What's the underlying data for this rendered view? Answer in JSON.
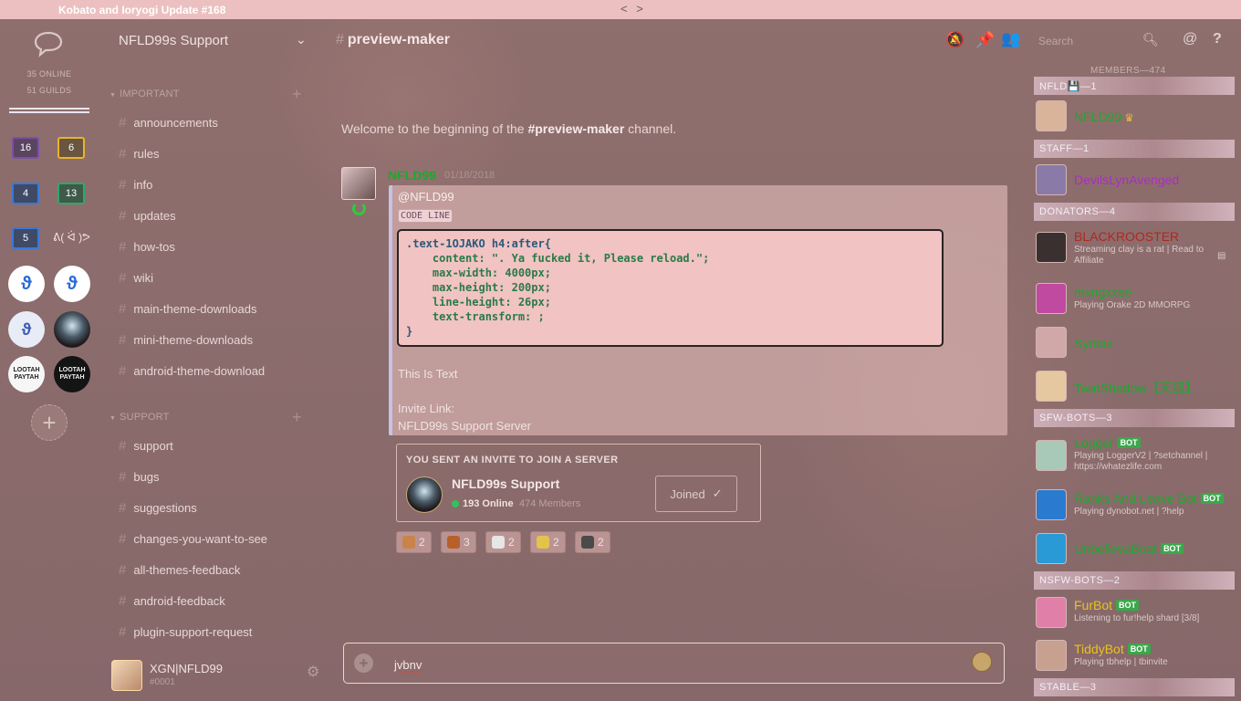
{
  "window": {
    "title": "Kobato and Ioryogi Update #168",
    "nav": "< >"
  },
  "guilds": {
    "online": "35 ONLINE",
    "guild_count": "51 GUILDS",
    "folders": [
      {
        "count": "16",
        "color": "#7c4fa8"
      },
      {
        "count": "6",
        "color": "#e8b42a"
      },
      {
        "count": "4",
        "color": "#3a78d6"
      },
      {
        "count": "13",
        "color": "#2fa86a"
      },
      {
        "count": "5",
        "color": "#3a78d6"
      }
    ],
    "lenny": "ᕕ( ᐛ )ᕗ",
    "lootah_label": "LOOTAH PAYTAH",
    "add_label": "+"
  },
  "server": {
    "name": "NFLD99s Support",
    "categories": [
      {
        "name": "IMPORTANT",
        "channels": [
          "announcements",
          "rules",
          "info",
          "updates",
          "how-tos",
          "wiki",
          "main-theme-downloads",
          "mini-theme-downloads",
          "android-theme-download"
        ]
      },
      {
        "name": "SUPPORT",
        "channels": [
          "support",
          "bugs",
          "suggestions",
          "changes-you-want-to-see",
          "all-themes-feedback",
          "android-feedback",
          "plugin-support-request"
        ]
      }
    ]
  },
  "user": {
    "name": "XGN|NFLD99",
    "tag": "#0001"
  },
  "header": {
    "channel": "preview-maker",
    "search_placeholder": "Search"
  },
  "chat": {
    "welcome_pre": "Welcome to the beginning of the ",
    "welcome_channel": "#preview-maker",
    "welcome_post": " channel.",
    "message": {
      "author": "NFLD99",
      "time": "01/18/2018",
      "mention": "@NFLD99",
      "code_tag": "CODE LINE",
      "code_lines": [
        ".text-1OJAKO h4:after{",
        "    content: \". Ya fucked it, Please reload.\";",
        "    max-width: 4000px;",
        "    max-height: 200px;",
        "    line-height: 26px;",
        "    text-transform: ;",
        "}"
      ],
      "text1": "This Is Text",
      "text2": "Invite Link:",
      "text3": "NFLD99s Support Server"
    },
    "invite": {
      "heading": "YOU SENT AN INVITE TO JOIN A SERVER",
      "server": "NFLD99s Support",
      "online": "193 Online",
      "members": "474 Members",
      "button": "Joined",
      "check": "✓"
    },
    "reactions": [
      {
        "count": "2",
        "color": "#c9844a"
      },
      {
        "count": "3",
        "color": "#b8602a"
      },
      {
        "count": "2",
        "color": "#e6e6e6"
      },
      {
        "count": "2",
        "color": "#e3c34a"
      },
      {
        "count": "2",
        "color": "#4a4a4a"
      }
    ],
    "input_value": "jvbnv"
  },
  "members": {
    "header": "MEMBERS—474",
    "roles": [
      {
        "name": "NFLD💾—1"
      },
      {
        "name": "STAFF—1"
      },
      {
        "name": "DONATORS—4"
      },
      {
        "name": "SFW-BOTS—3"
      },
      {
        "name": "NSFW-BOTS—2"
      },
      {
        "name": "STABLE—3"
      }
    ],
    "list": [
      {
        "name": "NFLD99",
        "color": "#1ea82e",
        "sub": "",
        "bot": false,
        "crown": "♛",
        "avatar": "#d9b49a"
      },
      {
        "name": "DevilsLynAvenged",
        "color": "#a82ec0",
        "sub": "",
        "bot": false,
        "crown": "",
        "avatar": "#8a7aa8"
      },
      {
        "name": "BLACKROOSTER",
        "color": "#b0281e",
        "sub": "Streaming clay is a rat | Read to Affiliate",
        "bot": false,
        "crown": "",
        "avatar": "#3a3030"
      },
      {
        "name": "mxngxxse",
        "color": "#1ea82e",
        "sub": "Playing Orake 2D MMORPG",
        "bot": false,
        "crown": "",
        "avatar": "#c04aa0"
      },
      {
        "name": "Syntax",
        "color": "#1ea82e",
        "sub": "",
        "bot": false,
        "crown": "",
        "avatar": "#d0a8a8"
      },
      {
        "name": "TwinShadow【天狐】",
        "color": "#1ea82e",
        "sub": "",
        "bot": false,
        "crown": "",
        "avatar": "#e6c8a0"
      },
      {
        "name": "Logger",
        "color": "#1ea82e",
        "sub": "Playing LoggerV2 | ?setchannel | https://whatezlife.com",
        "bot": true,
        "crown": "",
        "avatar": "#a8c8b8"
      },
      {
        "name": "Ranks And Leave Bot",
        "color": "#1ea82e",
        "sub": "Playing dynobot.net | ?help",
        "bot": true,
        "crown": "",
        "avatar": "#2a7ad0"
      },
      {
        "name": "UnbelievaBoat",
        "color": "#1ea82e",
        "sub": "",
        "bot": true,
        "crown": "",
        "avatar": "#2a9ad6"
      },
      {
        "name": "FurBot",
        "color": "#e8c21e",
        "sub": "Listening to fur!help shard [3/8]",
        "bot": true,
        "crown": "",
        "avatar": "#e080a8"
      },
      {
        "name": "TiddyBot",
        "color": "#e8c21e",
        "sub": "Playing tbhelp | tbinvite",
        "bot": true,
        "crown": "",
        "avatar": "#c8a090"
      }
    ],
    "bot_label": "BOT"
  }
}
